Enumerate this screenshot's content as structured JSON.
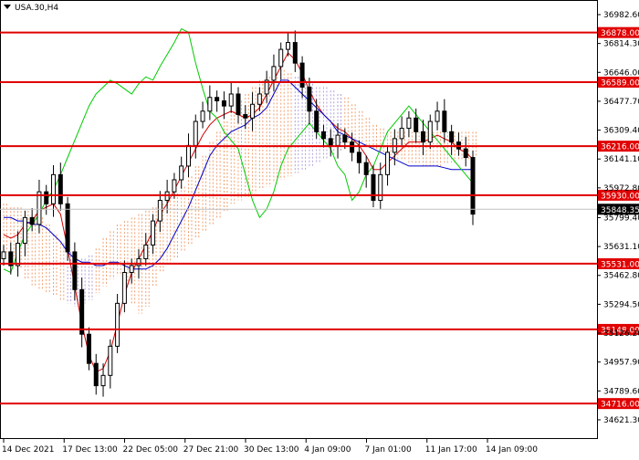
{
  "chart_data": {
    "type": "candlestick",
    "symbol_label": "USA.30,H4",
    "ylim": [
      34621.1,
      36982.6
    ],
    "y_ticks": [
      36982.6,
      36814.3,
      36646.0,
      36477.7,
      36309.4,
      36141.1,
      35972.8,
      35799.4,
      35631.1,
      35462.8,
      35294.5,
      35126.2,
      34957.9,
      34789.6,
      34621.3
    ],
    "x_labels": [
      "14 Dec 2021",
      "17 Dec 13:00",
      "22 Dec 05:00",
      "27 Dec 21:00",
      "30 Dec 13:00",
      "4 Jan 09:00",
      "7 Jan 01:00",
      "11 Jan 17:00",
      "14 Jan 09:00"
    ],
    "horizontal_levels": [
      {
        "value": 36878.0,
        "label": "36878.00"
      },
      {
        "value": 36589.0,
        "label": "36589.00"
      },
      {
        "value": 36216.0,
        "label": "36216.00"
      },
      {
        "value": 35930.0,
        "label": "35930.00"
      },
      {
        "value": 35531.0,
        "label": "35531.00"
      },
      {
        "value": 35148.0,
        "label": "35148.00"
      },
      {
        "value": 34716.0,
        "label": "34716.00"
      }
    ],
    "current_price": {
      "value": 35848.35,
      "label": "35848.35"
    },
    "candles_close": [
      35600,
      35520,
      35650,
      35800,
      35760,
      35950,
      35880,
      36050,
      35880,
      35600,
      35380,
      35120,
      34950,
      34820,
      34880,
      35050,
      35300,
      35480,
      35520,
      35560,
      35640,
      35780,
      35900,
      35950,
      36020,
      36100,
      36220,
      36360,
      36420,
      36500,
      36480,
      36450,
      36520,
      36400,
      36380,
      36460,
      36520,
      36600,
      36680,
      36780,
      36820,
      36700,
      36560,
      36420,
      36300,
      36260,
      36220,
      36280,
      36240,
      36180,
      36120,
      36050,
      35900,
      36050,
      36180,
      36260,
      36320,
      36380,
      36300,
      36240,
      36360,
      36420,
      36300,
      36240,
      36200,
      36150,
      35820
    ],
    "series": [
      {
        "name": "",
        "color": "#d00000",
        "values": [
          35700,
          35680,
          35700,
          35760,
          35780,
          35840,
          35860,
          35880,
          35820,
          35620,
          35400,
          35180,
          35000,
          34900,
          34920,
          35020,
          35180,
          35350,
          35480,
          35560,
          35640,
          35720,
          35820,
          35880,
          35960,
          36040,
          36120,
          36200,
          36280,
          36340,
          36380,
          36400,
          36420,
          36400,
          36380,
          36400,
          36440,
          36520,
          36600,
          36680,
          36760,
          36720,
          36640,
          36540,
          36460,
          36400,
          36360,
          36320,
          36300,
          36260,
          36220,
          36160,
          36080,
          36080,
          36120,
          36160,
          36200,
          36240,
          36240,
          36240,
          36260,
          36280,
          36260,
          36240,
          36200,
          36180,
          36140
        ]
      },
      {
        "name": "",
        "color": "#0000c8",
        "values": [
          35800,
          35800,
          35780,
          35780,
          35760,
          35760,
          35740,
          35700,
          35660,
          35600,
          35560,
          35540,
          35540,
          35520,
          35520,
          35540,
          35540,
          35520,
          35500,
          35500,
          35500,
          35520,
          35560,
          35620,
          35700,
          35780,
          35860,
          35960,
          36060,
          36160,
          36220,
          36260,
          36300,
          36320,
          36340,
          36380,
          36400,
          36440,
          36520,
          36600,
          36600,
          36560,
          36520,
          36480,
          36440,
          36400,
          36360,
          36300,
          36280,
          36260,
          36240,
          36220,
          36200,
          36180,
          36160,
          36140,
          36120,
          36100,
          36100,
          36100,
          36100,
          36100,
          36090,
          36080,
          36080,
          36080,
          36080
        ]
      },
      {
        "name": "",
        "color": "#00cc00",
        "values": [
          35500,
          35480,
          35600,
          35700,
          35760,
          35820,
          35900,
          35960,
          36050,
          36150,
          36250,
          36350,
          36450,
          36520,
          36560,
          36600,
          36580,
          36550,
          36520,
          36580,
          36620,
          36600,
          36680,
          36750,
          36820,
          36900,
          36880,
          36700,
          36550,
          36420,
          36380,
          36300,
          36250,
          36200,
          36050,
          35900,
          35800,
          35850,
          35950,
          36100,
          36200,
          36250,
          36300,
          36350,
          36300,
          36250,
          36200,
          36100,
          36050,
          35900,
          35950,
          36050,
          36100,
          36200,
          36300,
          36350,
          36400,
          36450,
          36400,
          36350,
          36300,
          36250,
          36200,
          36150,
          36100,
          36050,
          36000
        ]
      }
    ],
    "cloud_upper": [
      35880,
      35860,
      35860,
      35840,
      35820,
      35800,
      35760,
      35700,
      35650,
      35600,
      35560,
      35560,
      35580,
      35620,
      35680,
      35720,
      35760,
      35780,
      35800,
      35820,
      35840,
      35860,
      35880,
      35900,
      35940,
      35980,
      36040,
      36100,
      36160,
      36240,
      36300,
      36360,
      36420,
      36480,
      36520,
      36560,
      36600,
      36620,
      36640,
      36660,
      36640,
      36620,
      36600,
      36580,
      36560,
      36560,
      36540,
      36520,
      36500,
      36460,
      36420,
      36380,
      36340,
      36320,
      36300,
      36300,
      36300,
      36300,
      36300,
      36300,
      36300,
      36300,
      36300,
      36300,
      36300,
      36300,
      36300
    ],
    "cloud_lower": [
      35600,
      35560,
      35500,
      35440,
      35400,
      35380,
      35360,
      35340,
      35320,
      35300,
      35280,
      35300,
      35320,
      35360,
      35400,
      35440,
      35460,
      35400,
      35300,
      35240,
      35280,
      35400,
      35480,
      35520,
      35560,
      35600,
      35640,
      35680,
      35720,
      35760,
      35800,
      35840,
      35880,
      35900,
      35920,
      35940,
      35960,
      35980,
      36000,
      36020,
      36040,
      36060,
      36080,
      36100,
      36120,
      36140,
      36160,
      36180,
      36200,
      36220,
      36240,
      36220,
      36200,
      36180,
      36160,
      36140,
      36130,
      36120,
      36110,
      36100,
      36100,
      36100,
      36110,
      36120,
      36130,
      36140,
      36150
    ]
  }
}
